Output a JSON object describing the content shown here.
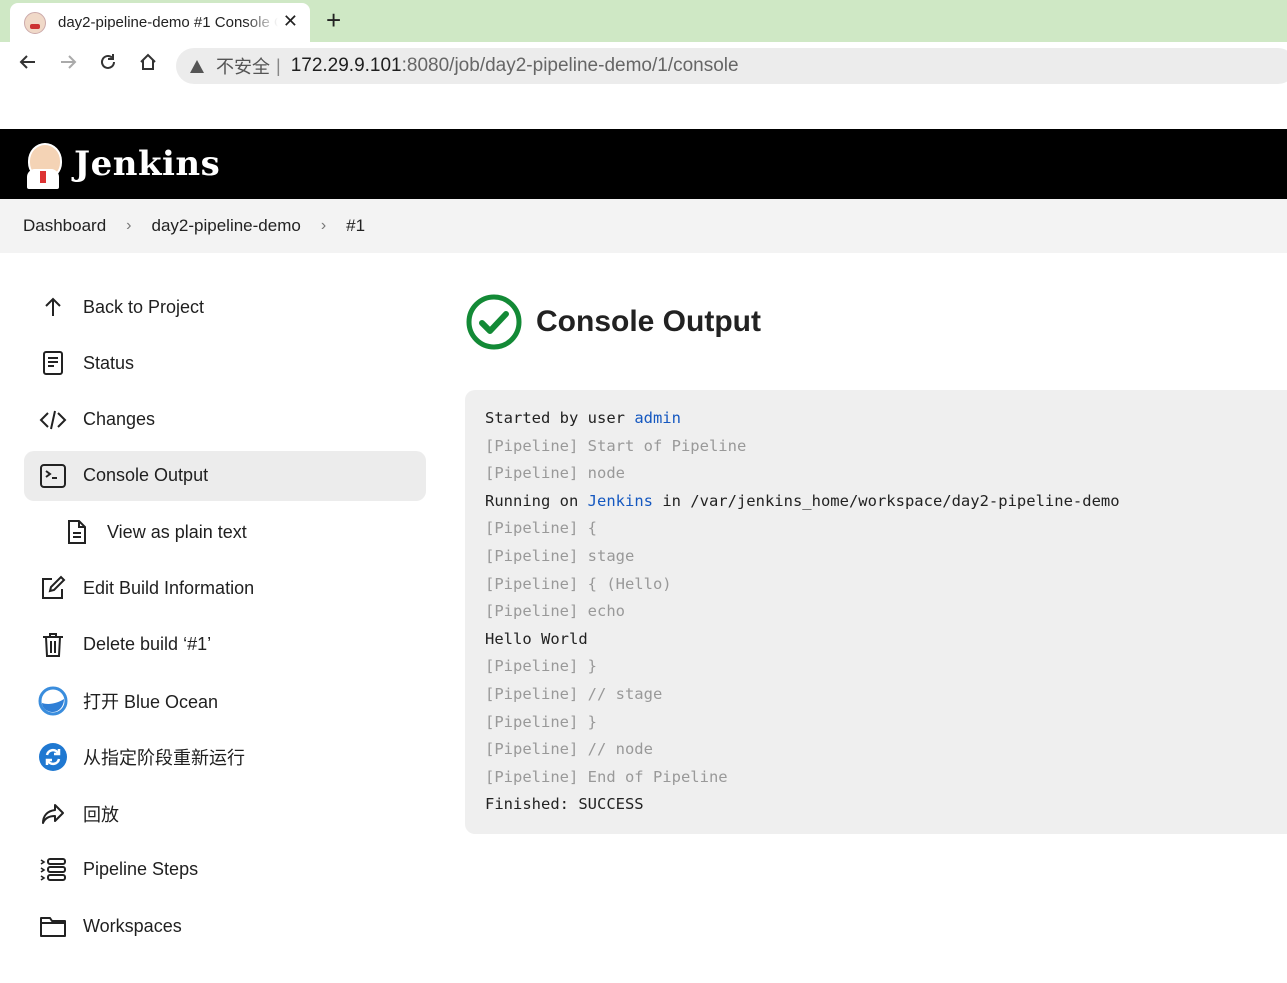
{
  "browser": {
    "tab_title": "day2-pipeline-demo #1 Console Output",
    "tab_close": "✕",
    "new_tab": "+",
    "security_label": "不安全",
    "url_separator": "|",
    "url_host": "172.29.9.101",
    "url_rest": ":8080/job/day2-pipeline-demo/1/console"
  },
  "header": {
    "title": "Jenkins"
  },
  "breadcrumb": {
    "items": [
      "Dashboard",
      "day2-pipeline-demo",
      "#1"
    ],
    "separator": "›"
  },
  "sidebar": {
    "items": [
      {
        "label": "Back to Project",
        "icon": "arrow-up-icon"
      },
      {
        "label": "Status",
        "icon": "document-icon"
      },
      {
        "label": "Changes",
        "icon": "code-icon"
      },
      {
        "label": "Console Output",
        "icon": "terminal-icon"
      },
      {
        "label": "View as plain text",
        "icon": "file-text-icon"
      },
      {
        "label": "Edit Build Information",
        "icon": "edit-icon"
      },
      {
        "label": "Delete build ‘#1’",
        "icon": "trash-icon"
      },
      {
        "label": "打开 Blue Ocean",
        "icon": "blue-ocean-icon"
      },
      {
        "label": "从指定阶段重新运行",
        "icon": "restart-icon"
      },
      {
        "label": "回放",
        "icon": "replay-icon"
      },
      {
        "label": "Pipeline Steps",
        "icon": "list-icon"
      },
      {
        "label": "Workspaces",
        "icon": "folder-icon"
      }
    ],
    "active_index": 3
  },
  "main": {
    "title": "Console Output",
    "console": {
      "started_prefix": "Started by user ",
      "started_user": "admin",
      "running_prefix": "Running on ",
      "running_node": "Jenkins",
      "running_suffix": " in /var/jenkins_home/workspace/day2-pipeline-demo",
      "lines": [
        "[Pipeline] Start of Pipeline",
        "[Pipeline] node",
        "[Pipeline] {",
        "[Pipeline] stage",
        "[Pipeline] { (Hello)",
        "[Pipeline] echo",
        "Hello World",
        "[Pipeline] }",
        "[Pipeline] // stage",
        "[Pipeline] }",
        "[Pipeline] // node",
        "[Pipeline] End of Pipeline",
        "Finished: SUCCESS"
      ]
    }
  },
  "colors": {
    "success": "#138a36",
    "link": "#1558c0",
    "header_bg": "#000000"
  }
}
